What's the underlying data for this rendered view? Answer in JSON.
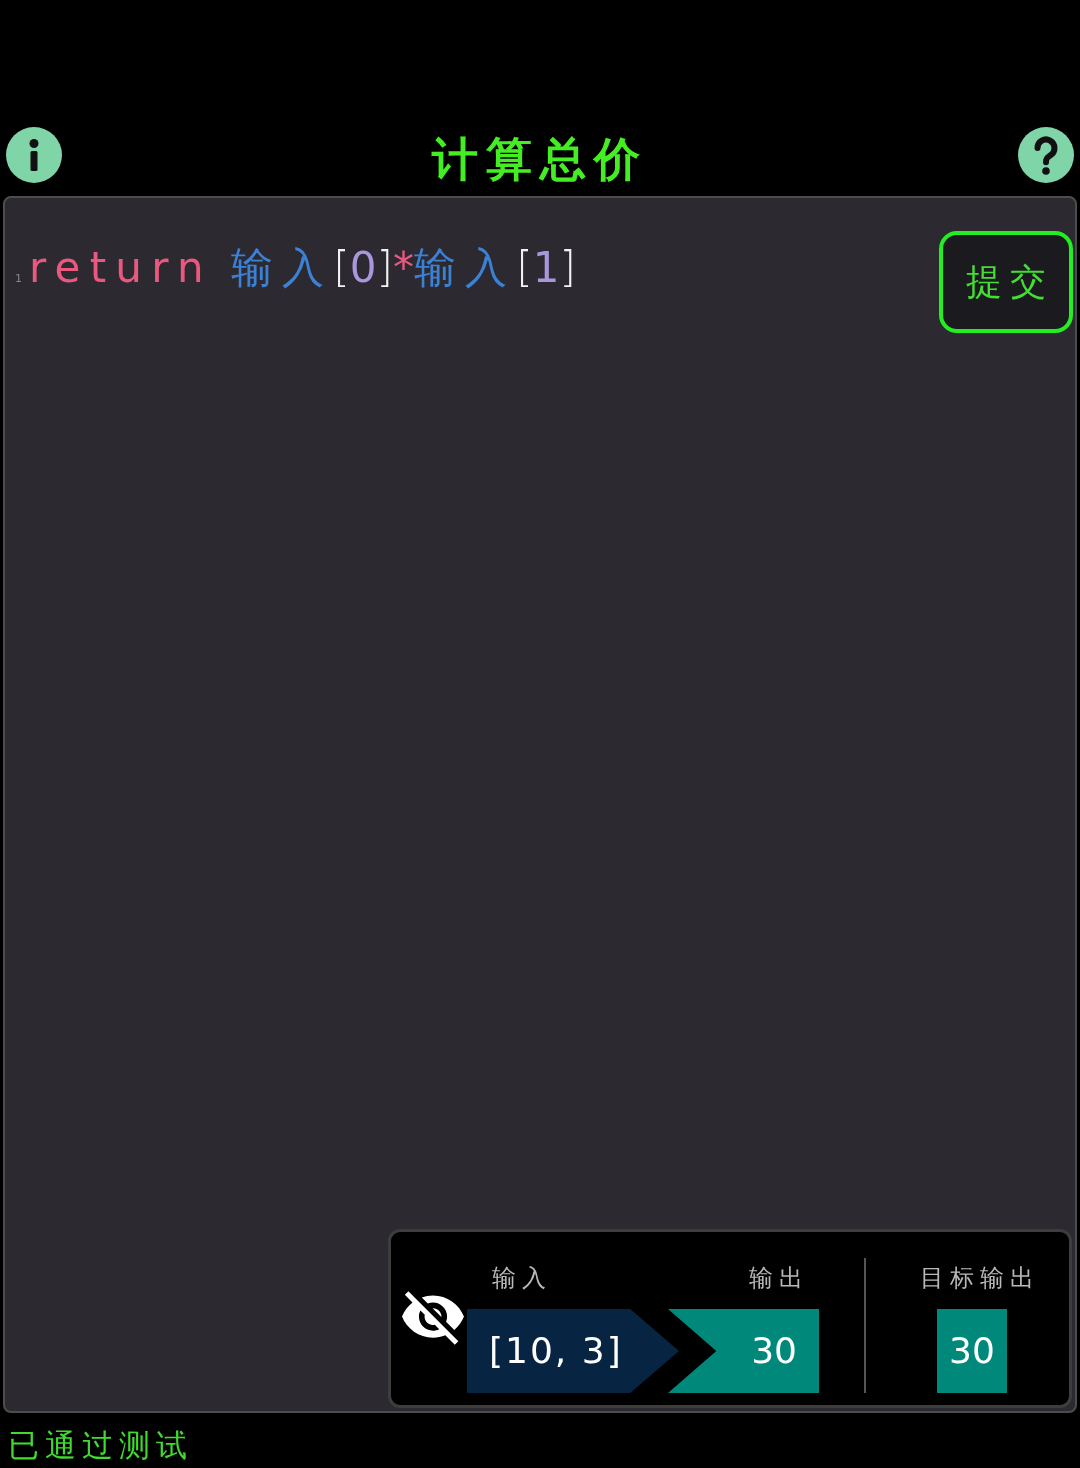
{
  "header": {
    "title": "计算总价"
  },
  "editor": {
    "lines": [
      {
        "number": "1",
        "tokens": [
          {
            "kind": "keyword",
            "text": "return"
          },
          {
            "kind": "identifier",
            "text": "输入"
          },
          {
            "kind": "bracket",
            "text": "["
          },
          {
            "kind": "number",
            "text": "0"
          },
          {
            "kind": "bracket",
            "text": "]"
          },
          {
            "kind": "operator",
            "text": "*"
          },
          {
            "kind": "identifier",
            "text": "输入"
          },
          {
            "kind": "bracket",
            "text": "["
          },
          {
            "kind": "number",
            "text": "1"
          },
          {
            "kind": "bracket",
            "text": "]"
          }
        ]
      }
    ]
  },
  "submit_button": {
    "label": "提交"
  },
  "test_case": {
    "hidden": true,
    "input": {
      "label": "输入",
      "value": "[10, 3]"
    },
    "output": {
      "label": "输出",
      "value": "30"
    },
    "target": {
      "label": "目标输出",
      "value": "30"
    }
  },
  "status": {
    "text": "已通过测试",
    "passed": true
  }
}
